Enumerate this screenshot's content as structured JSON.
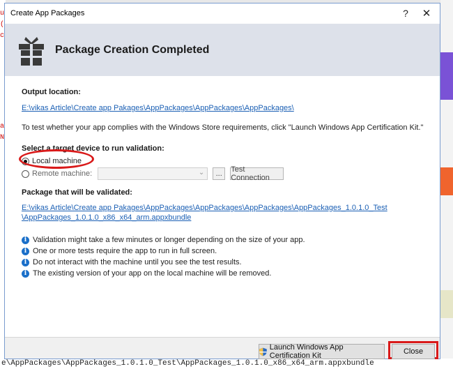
{
  "dialog": {
    "title": "Create App Packages",
    "help_glyph": "?",
    "close_glyph": "✕",
    "header_title": "Package Creation Completed"
  },
  "output": {
    "label": "Output location:",
    "path": "E:\\vikas Article\\Create app Pakages\\AppPackages\\AppPackages\\AppPackages\\"
  },
  "wack_note": "To test whether your app complies with the Windows Store requirements, click \"Launch Windows App Certification Kit.\"",
  "target": {
    "label": "Select a target device to run validation:",
    "local_label": "Local machine",
    "remote_label": "Remote machine:",
    "selected": "Local machine",
    "browse_label": "...",
    "test_connection_label": "Test Connection"
  },
  "package": {
    "label": "Package that will be validated:",
    "path_line1": "E:\\vikas Article\\Create app Pakages\\AppPackages\\AppPackages\\AppPackages\\AppPackages_1.0.1.0_Test",
    "path_line2": "\\AppPackages_1.0.1.0_x86_x64_arm.appxbundle"
  },
  "info_items": [
    "Validation might take a few minutes or longer depending on the size of your app.",
    "One or more tests require the app to run in full screen.",
    "Do not interact with the machine until you see the test results.",
    "The existing version of your app on the local machine will be removed."
  ],
  "info_glyph": "i",
  "footer": {
    "launch_label": "Launch Windows App Certification Kit",
    "close_label": "Close"
  },
  "background": {
    "bottom_text": "e\\AppPackages\\AppPackages_1.0.1.0_Test\\AppPackages_1.0.1.0_x86_x64_arm.appxbundle"
  },
  "colors": {
    "header_bg": "#dde1ea",
    "link": "#1a5fb4",
    "annotation": "#d91a1a",
    "info_icon": "#1a6fc9"
  }
}
